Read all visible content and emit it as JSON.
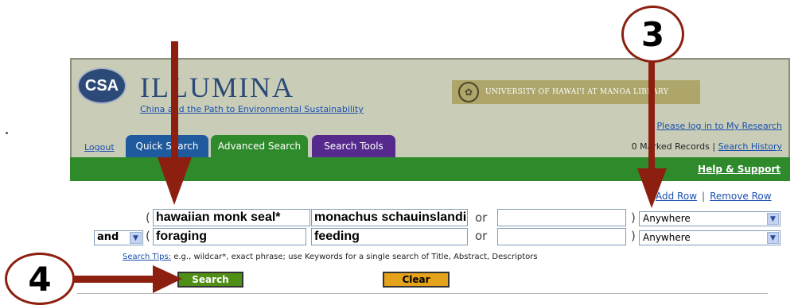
{
  "header": {
    "logo": "CSA",
    "product": "ILLUMINA",
    "subtitle": "China and the Path to Environmental Sustainability",
    "library_banner": "UNIVERSITY OF HAWAI'I AT MANOA LIBRARY",
    "login_link": "Please log in to My Research",
    "marked_records": "0 Marked Records",
    "separator": "|",
    "search_history": "Search History"
  },
  "nav": {
    "logout": "Logout",
    "tabs": [
      "Quick Search",
      "Advanced Search",
      "Search Tools"
    ],
    "active_tab": "Advanced Search",
    "help": "Help & Support"
  },
  "search": {
    "add_row": "Add Row",
    "row_sep": "|",
    "remove_row": "Remove Row",
    "open_paren": "(",
    "close_paren": ")",
    "or": "or",
    "rows": [
      {
        "connector": "",
        "terms": [
          "hawaiian monk seal*",
          "monachus schauinslandi",
          ""
        ],
        "field": "Anywhere"
      },
      {
        "connector": "and",
        "terms": [
          "foraging",
          "feeding",
          ""
        ],
        "field": "Anywhere"
      }
    ],
    "tips_link": "Search Tips:",
    "tips_text": " e.g., wildcar*, exact phrase; use Keywords for a single search of Title, Abstract, Descriptors",
    "search_button": "Search",
    "clear_button": "Clear"
  },
  "annotations": {
    "step_3": "3",
    "step_4": "4",
    "arrow_color": "#8c1f10"
  },
  "colors": {
    "green_bar": "#2e8a2b",
    "quick_tab": "#1f5a9e",
    "tools_tab": "#552a8c",
    "search_button": "#4f8f16",
    "clear_button": "#e5a21b"
  }
}
